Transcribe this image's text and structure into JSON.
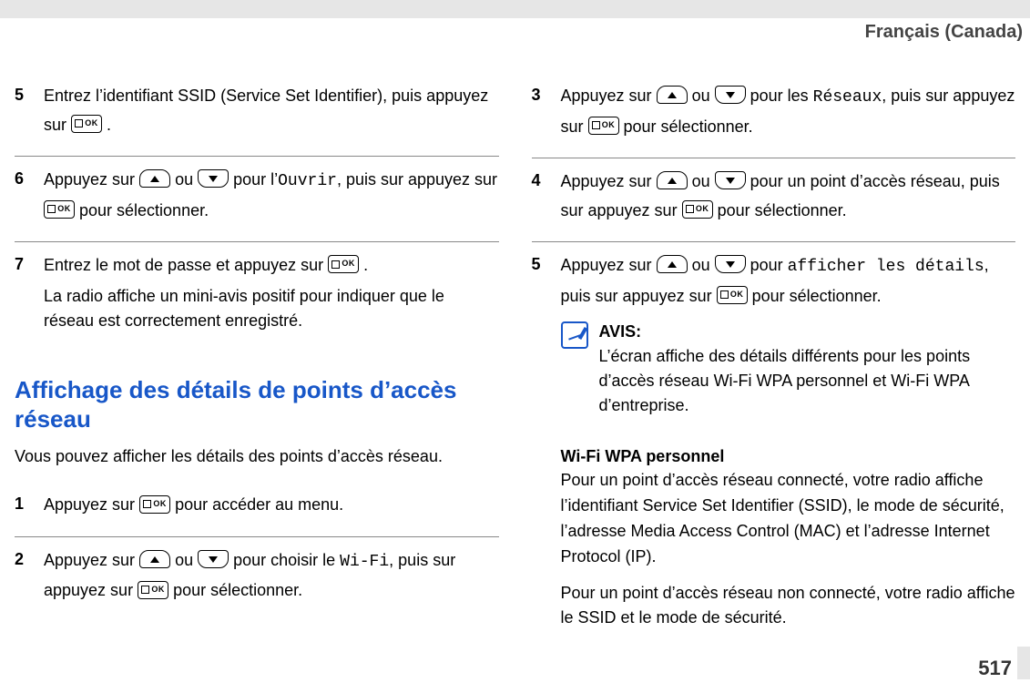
{
  "header": {
    "language": "Français (Canada)"
  },
  "left": {
    "steps_a": [
      {
        "num": "5",
        "parts": [
          {
            "t": "text",
            "v": "Entrez l’identifiant SSID (Service Set Identifier), puis appuyez sur "
          },
          {
            "t": "ok"
          },
          {
            "t": "text",
            "v": " ."
          }
        ]
      },
      {
        "num": "6",
        "parts": [
          {
            "t": "text",
            "v": "Appuyez sur "
          },
          {
            "t": "up"
          },
          {
            "t": "text",
            "v": " ou "
          },
          {
            "t": "down"
          },
          {
            "t": "text",
            "v": " pour l’"
          },
          {
            "t": "mono",
            "v": "Ouvrir"
          },
          {
            "t": "text",
            "v": ", puis sur appuyez sur "
          },
          {
            "t": "ok"
          },
          {
            "t": "text",
            "v": " pour sélectionner."
          }
        ]
      },
      {
        "num": "7",
        "parts": [
          {
            "t": "text",
            "v": "Entrez le mot de passe et appuyez sur "
          },
          {
            "t": "ok"
          },
          {
            "t": "text",
            "v": " ."
          }
        ],
        "extra": "La radio affiche un mini-avis positif pour indiquer que le réseau est correctement enregistré."
      }
    ],
    "section": {
      "title": "Affichage des détails de points d’accès réseau",
      "intro": "Vous pouvez afficher les détails des points d’accès réseau."
    },
    "steps_b": [
      {
        "num": "1",
        "parts": [
          {
            "t": "text",
            "v": "Appuyez sur "
          },
          {
            "t": "ok"
          },
          {
            "t": "text",
            "v": " pour accéder au menu."
          }
        ]
      },
      {
        "num": "2",
        "parts": [
          {
            "t": "text",
            "v": "Appuyez sur "
          },
          {
            "t": "up"
          },
          {
            "t": "text",
            "v": " ou "
          },
          {
            "t": "down"
          },
          {
            "t": "text",
            "v": " pour choisir le "
          },
          {
            "t": "mono",
            "v": "Wi-Fi"
          },
          {
            "t": "text",
            "v": ", puis sur appuyez sur "
          },
          {
            "t": "ok"
          },
          {
            "t": "text",
            "v": " pour sélectionner."
          }
        ]
      }
    ]
  },
  "right": {
    "steps": [
      {
        "num": "3",
        "parts": [
          {
            "t": "text",
            "v": "Appuyez sur "
          },
          {
            "t": "up"
          },
          {
            "t": "text",
            "v": " ou "
          },
          {
            "t": "down"
          },
          {
            "t": "text",
            "v": " pour les "
          },
          {
            "t": "mono",
            "v": "Réseaux"
          },
          {
            "t": "text",
            "v": ", puis sur appuyez sur "
          },
          {
            "t": "ok"
          },
          {
            "t": "text",
            "v": " pour sélectionner."
          }
        ]
      },
      {
        "num": "4",
        "parts": [
          {
            "t": "text",
            "v": "Appuyez sur "
          },
          {
            "t": "up"
          },
          {
            "t": "text",
            "v": " ou "
          },
          {
            "t": "down"
          },
          {
            "t": "text",
            "v": " pour un point d’accès réseau, puis sur appuyez sur "
          },
          {
            "t": "ok"
          },
          {
            "t": "text",
            "v": " pour sélectionner."
          }
        ]
      },
      {
        "num": "5",
        "parts": [
          {
            "t": "text",
            "v": "Appuyez sur "
          },
          {
            "t": "up"
          },
          {
            "t": "text",
            "v": " ou "
          },
          {
            "t": "down"
          },
          {
            "t": "text",
            "v": " pour "
          },
          {
            "t": "mono",
            "v": "afficher les détails"
          },
          {
            "t": "text",
            "v": ", puis sur appuyez sur "
          },
          {
            "t": "ok"
          },
          {
            "t": "text",
            "v": " pour sélectionner."
          }
        ],
        "note": {
          "label": "AVIS:",
          "text": "L’écran affiche des détails différents pour les points d’accès réseau Wi-Fi WPA personnel et Wi-Fi WPA d’entreprise."
        }
      }
    ],
    "sub": {
      "heading": "Wi-Fi WPA personnel",
      "p1": "Pour un point d’accès réseau connecté, votre radio affiche l’identifiant Service Set Identifier (SSID), le mode de sécurité, l’adresse Media Access Control (MAC) et l’adresse Internet Protocol (IP).",
      "p2": "Pour un point d’accès réseau non connecté, votre radio affiche le SSID et le mode de sécurité."
    }
  },
  "pagenum": "517"
}
